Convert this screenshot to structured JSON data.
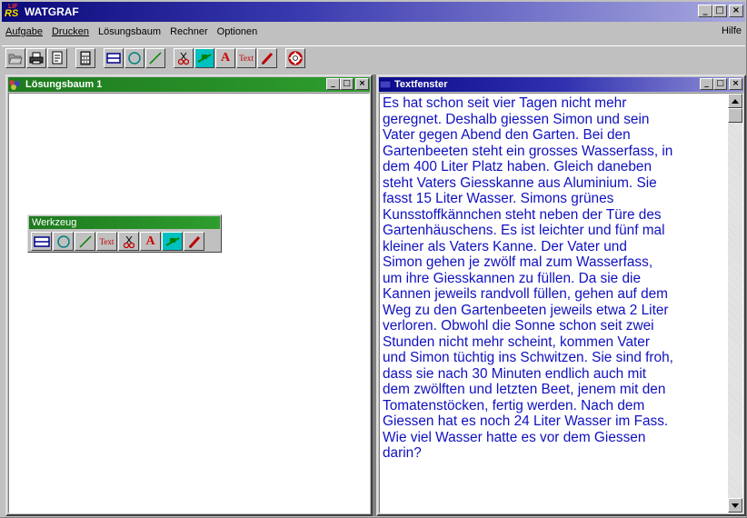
{
  "app": {
    "title": "WATGRAF",
    "logo_small": "LIF",
    "logo_big": "RS"
  },
  "window_controls": {
    "minimize": "_",
    "maximize": "□",
    "close": "×"
  },
  "menu": {
    "items": [
      {
        "label": "Aufgabe"
      },
      {
        "label": "Drucken"
      },
      {
        "label": "Lösungsbaum"
      },
      {
        "label": "Rechner"
      },
      {
        "label": "Optionen"
      }
    ],
    "help": "Hilfe"
  },
  "toolbar": {
    "text_button": "Text",
    "a_button": "A"
  },
  "solution_tree_window": {
    "title": "Lösungsbaum 1",
    "title_color": "#2e9e2e"
  },
  "toolbox": {
    "title": "Werkzeug",
    "text_button": "Text",
    "a_button": "A"
  },
  "text_window": {
    "title": "Textfenster",
    "lines": [
      "Es hat schon seit vier Tagen nicht mehr",
      "geregnet. Deshalb giessen Simon und sein",
      "Vater gegen Abend den Garten. Bei den",
      "Gartenbeeten steht ein grosses Wasserfass, in",
      "dem 400 Liter Platz haben. Gleich daneben",
      "steht Vaters Giesskanne aus Aluminium. Sie",
      "fasst 15 Liter Wasser. Simons grünes",
      "Kunsstoffkännchen steht neben der Türe des",
      "Gartenhäuschens. Es ist leichter und fünf mal",
      "kleiner als Vaters Kanne. Der Vater und",
      "Simon gehen je zwölf mal zum Wasserfass,",
      "um ihre Giesskannen zu füllen. Da sie die",
      "Kannen jeweils randvoll füllen, gehen auf dem",
      "Weg zu den Gartenbeeten jeweils etwa 2 Liter",
      "verloren. Obwohl die Sonne schon seit zwei",
      "Stunden nicht mehr scheint, kommen Vater",
      "und Simon tüchtig ins Schwitzen. Sie sind froh,",
      "dass sie nach 30 Minuten endlich auch mit",
      "dem zwölften und letzten Beet, jenem mit den",
      "Tomatenstöcken, fertig werden. Nach dem",
      "Giessen hat es noch 24 Liter Wasser im Fass.",
      "Wie viel Wasser hatte es vor dem Giessen",
      "darin?"
    ],
    "text_color": "#1010c0"
  }
}
